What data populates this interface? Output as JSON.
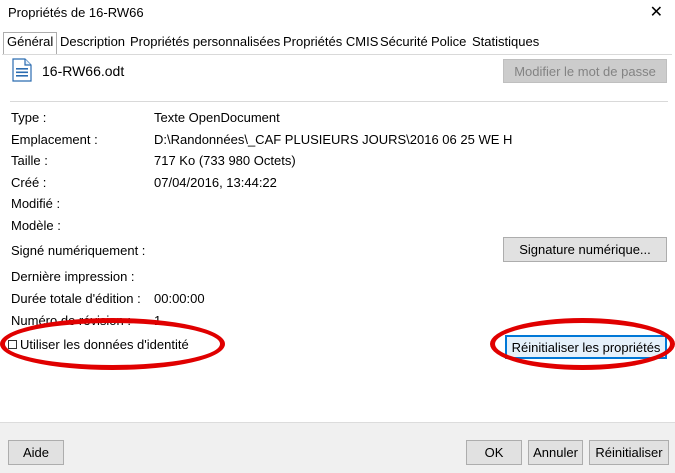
{
  "window": {
    "title": "Propriétés de 16-RW66",
    "close_glyph": "✕"
  },
  "tabs": [
    {
      "label": "Général",
      "active": true
    },
    {
      "label": "Description"
    },
    {
      "label": "Propriétés personnalisées"
    },
    {
      "label": "Propriétés CMIS"
    },
    {
      "label": "Sécurité"
    },
    {
      "label": "Police"
    },
    {
      "label": "Statistiques"
    }
  ],
  "general": {
    "filename": "16-RW66.odt",
    "file_icon": "document-icon",
    "change_password_button": "Modifier le mot de passe",
    "fields": {
      "type": {
        "label": "Type :",
        "value": "Texte OpenDocument"
      },
      "location": {
        "label": "Emplacement :",
        "value": "D:\\Randonnées\\_CAF PLUSIEURS JOURS\\2016 06 25 WE H"
      },
      "size": {
        "label": "Taille :",
        "value": "717 Ko (733 980 Octets)"
      },
      "created": {
        "label": "Créé :",
        "value": "07/04/2016, 13:44:22"
      },
      "modified": {
        "label": "Modifié :",
        "value": ""
      },
      "template": {
        "label": "Modèle :",
        "value": ""
      },
      "signed": {
        "label": "Signé numériquement :",
        "value": ""
      },
      "last_printed": {
        "label": "Dernière impression :",
        "value": ""
      },
      "total_editing_time": {
        "label": "Durée totale d'édition :",
        "value": "00:00:00"
      },
      "revision_number": {
        "label": "Numéro de révision :",
        "value": "1"
      }
    },
    "digital_signature_button": "Signature numérique...",
    "use_user_data_checkbox": {
      "label": "Utiliser les données d'identité",
      "checked": false
    },
    "reset_properties_button": "Réinitialiser les propriétés"
  },
  "footer": {
    "help_button": "Aide",
    "ok_button": "OK",
    "cancel_button": "Annuler",
    "reset_button": "Réinitialiser"
  },
  "annotation_color": "#e00000"
}
